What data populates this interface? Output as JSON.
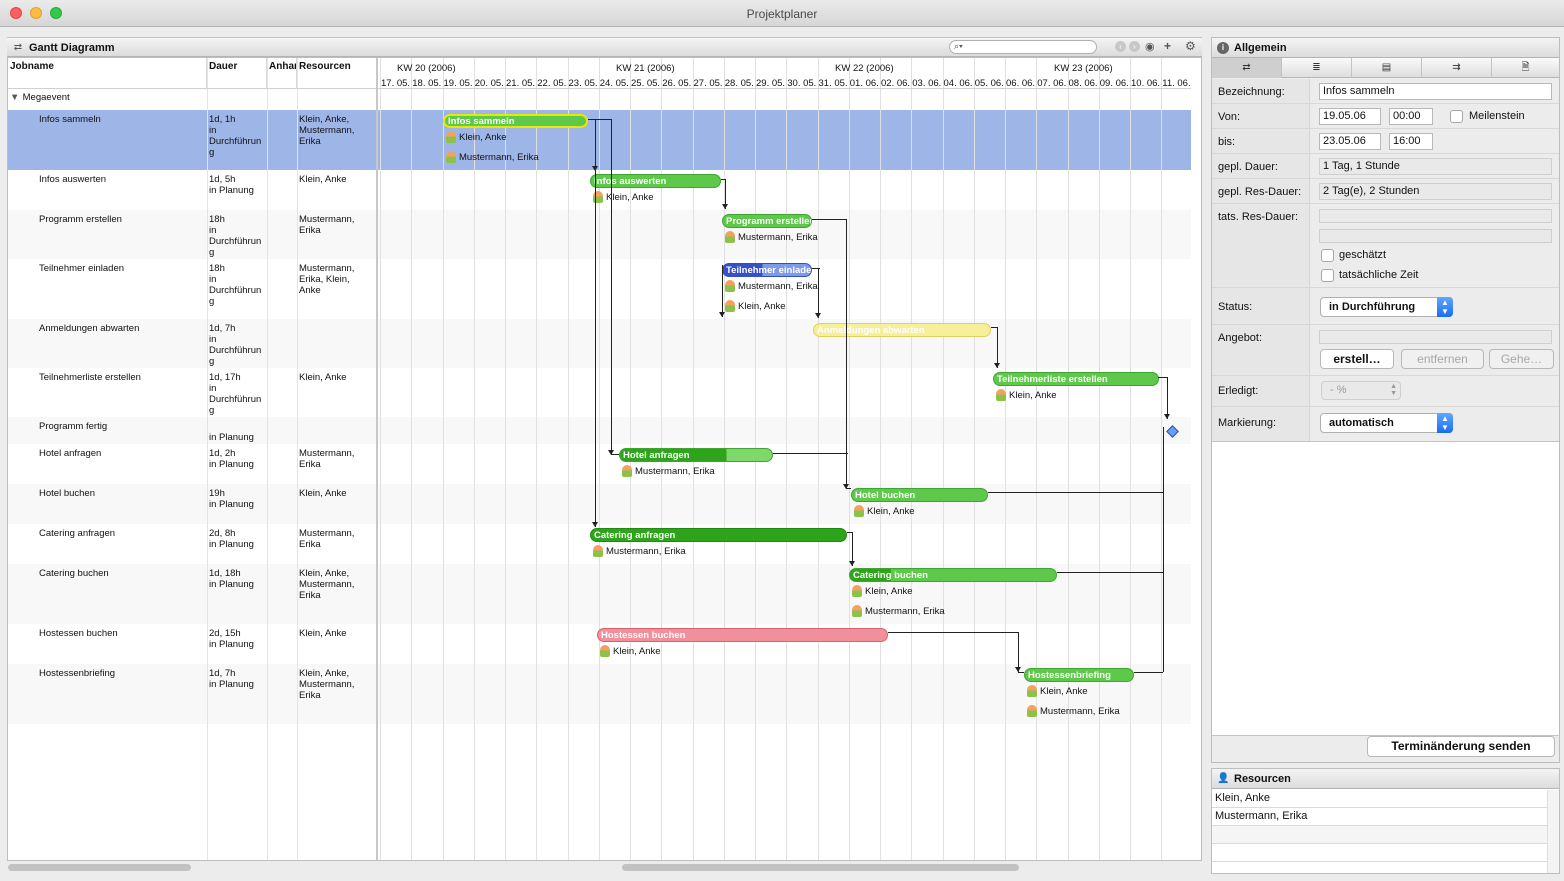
{
  "window": {
    "title": "Projektplaner"
  },
  "gantt": {
    "panel_title": "Gantt Diagramm",
    "search_placeholder": "",
    "columns": [
      "Jobname",
      "Dauer",
      "Anhang",
      "Resourcen"
    ],
    "group": "Megaevent",
    "weeks": [
      "KW 20 (2006)",
      "KW 21 (2006)",
      "KW 22 (2006)",
      "KW 23 (2006)"
    ],
    "dates": [
      "17. 05.",
      "18. 05.",
      "19. 05.",
      "20. 05.",
      "21. 05.",
      "22. 05.",
      "23. 05.",
      "24. 05.",
      "25. 05.",
      "26. 05.",
      "27. 05.",
      "28. 05.",
      "29. 05.",
      "30. 05.",
      "31. 05.",
      "01. 06.",
      "02. 06.",
      "03. 06.",
      "04. 06.",
      "05. 06.",
      "06. 06.",
      "07. 06.",
      "08. 06.",
      "09. 06.",
      "10. 06.",
      "11. 06."
    ],
    "rows": [
      {
        "name": "Infos sammeln",
        "dauer": "1d, 1h\nin\nDurchführun\ng",
        "res": "Klein, Anke,\nMustermann,\nErika",
        "bar": "Infos sammeln",
        "people": [
          "Klein, Anke",
          "Mustermann, Erika"
        ],
        "color": "green",
        "selected": true
      },
      {
        "name": "Infos auswerten",
        "dauer": "1d, 5h\nin Planung",
        "res": "Klein, Anke",
        "bar": "Infos auswerten",
        "people": [
          "Klein, Anke"
        ],
        "color": "green"
      },
      {
        "name": "Programm erstellen",
        "dauer": "18h\nin\nDurchführun\ng",
        "res": "Mustermann,\nErika",
        "bar": "Programm erstellen",
        "people": [
          "Mustermann, Erika"
        ],
        "color": "green"
      },
      {
        "name": "Teilnehmer einladen",
        "dauer": "18h\nin\nDurchführun\ng",
        "res": "Mustermann,\nErika, Klein,\nAnke",
        "bar": "Teilnehmer einladen",
        "people": [
          "Mustermann, Erika",
          "Klein, Anke"
        ],
        "color": "blue"
      },
      {
        "name": "Anmeldungen abwarten",
        "dauer": "1d, 7h\nin\nDurchführun\ng",
        "res": "",
        "bar": "Anmeldungen abwarten",
        "people": [],
        "color": "yellow"
      },
      {
        "name": "Teilnehmerliste erstellen",
        "dauer": "1d, 17h\nin\nDurchführun\ng",
        "res": "Klein, Anke",
        "bar": "Teilnehmerliste erstellen",
        "people": [
          "Klein, Anke"
        ],
        "color": "green"
      },
      {
        "name": "Programm fertig",
        "dauer": "\nin Planung",
        "res": "",
        "bar": "",
        "people": [],
        "color": "milestone"
      },
      {
        "name": "Hotel anfragen",
        "dauer": "1d, 2h\nin Planung",
        "res": "Mustermann,\nErika",
        "bar": "Hotel anfragen",
        "people": [
          "Mustermann, Erika"
        ],
        "color": "green"
      },
      {
        "name": "Hotel buchen",
        "dauer": "19h\nin Planung",
        "res": "Klein, Anke",
        "bar": "Hotel buchen",
        "people": [
          "Klein, Anke"
        ],
        "color": "green"
      },
      {
        "name": "Catering anfragen",
        "dauer": "2d, 8h\nin Planung",
        "res": "Mustermann,\nErika",
        "bar": "Catering anfragen",
        "people": [
          "Mustermann, Erika"
        ],
        "color": "darkgreen"
      },
      {
        "name": "Catering buchen",
        "dauer": "1d, 18h\nin Planung",
        "res": "Klein, Anke,\nMustermann,\nErika",
        "bar": "Catering buchen",
        "people": [
          "Klein, Anke",
          "Mustermann, Erika"
        ],
        "color": "green"
      },
      {
        "name": "Hostessen buchen",
        "dauer": "2d, 15h\nin Planung",
        "res": "Klein, Anke",
        "bar": "Hostessen buchen",
        "people": [
          "Klein, Anke"
        ],
        "color": "red"
      },
      {
        "name": "Hostessenbriefing",
        "dauer": "1d, 7h\nin Planung",
        "res": "Klein, Anke,\nMustermann,\nErika",
        "bar": "Hostessenbriefing",
        "people": [
          "Klein, Anke",
          "Mustermann, Erika"
        ],
        "color": "green"
      }
    ]
  },
  "details": {
    "panel_title": "Allgemein",
    "tabs": [
      "⇄",
      "≣",
      "▤",
      "⇉",
      "🗎"
    ],
    "labels": {
      "bezeichnung": "Bezeichnung:",
      "von": "Von:",
      "bis": "bis:",
      "gepl_dauer": "gepl. Dauer:",
      "gepl_res": "gepl. Res-Dauer:",
      "tats_res": "tats. Res-Dauer:",
      "status": "Status:",
      "angebot": "Angebot:",
      "erledigt": "Erledigt:",
      "markierung": "Markierung:"
    },
    "values": {
      "bezeichnung": "Infos sammeln",
      "von_datum": "19.05.06",
      "von_zeit": "00:00",
      "bis_datum": "23.05.06",
      "bis_zeit": "16:00",
      "gepl_dauer": "1 Tag, 1 Stunde",
      "gepl_res": "2 Tag(e), 2 Stunden",
      "tats_res": "",
      "status": "in Durchführung",
      "angebot": "",
      "erledigt": "- %",
      "markierung": "automatisch"
    },
    "meilenstein_label": "Meilenstein",
    "geschaetzt_label": "geschätzt",
    "tatsaechlich_label": "tatsächliche Zeit",
    "btn_erstellen": "erstell…",
    "btn_entfernen": "entfernen",
    "btn_gehe": "Gehe…",
    "btn_send": "Terminänderung senden"
  },
  "resources": {
    "panel_title": "Resourcen",
    "items": [
      "Klein, Anke",
      "Mustermann, Erika"
    ]
  }
}
